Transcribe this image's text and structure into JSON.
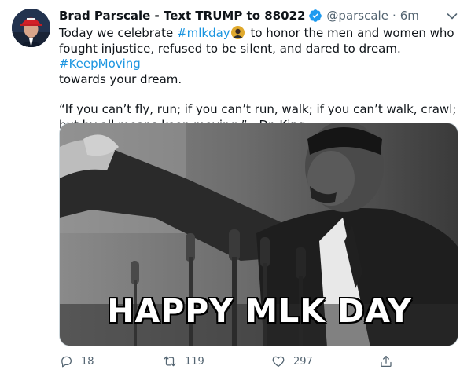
{
  "author": {
    "name": "Brad Parscale - Text TRUMP to 88022",
    "handle": "@parscale",
    "separator": "·",
    "time": "6m"
  },
  "tweet": {
    "line1_pre": "Today we celebrate ",
    "hashtag_mlk": "#mlkday",
    "line1_post": " to honor the men and women who fought injustice, refused to be silent, and dared to dream. ",
    "hashtag_keep": "#KeepMoving",
    "line1_end": " towards your dream.",
    "quote": "“If you can’t fly, run; if you can’t run, walk; if you can’t walk, crawl; but by all means keep moving.” - Dr. King"
  },
  "media": {
    "overlay_text": "HAPPY MLK DAY"
  },
  "actions": {
    "replies": "18",
    "retweets": "119",
    "likes": "297"
  },
  "colors": {
    "link": "#1b95e0",
    "verified": "#1d9bf0",
    "muted": "#536471",
    "reply_accent": "#e0245e"
  },
  "icons": [
    "verified-badge-icon",
    "caret-down-icon",
    "mlk-hashflag-icon",
    "reply-icon",
    "retweet-icon",
    "like-icon",
    "share-icon"
  ]
}
